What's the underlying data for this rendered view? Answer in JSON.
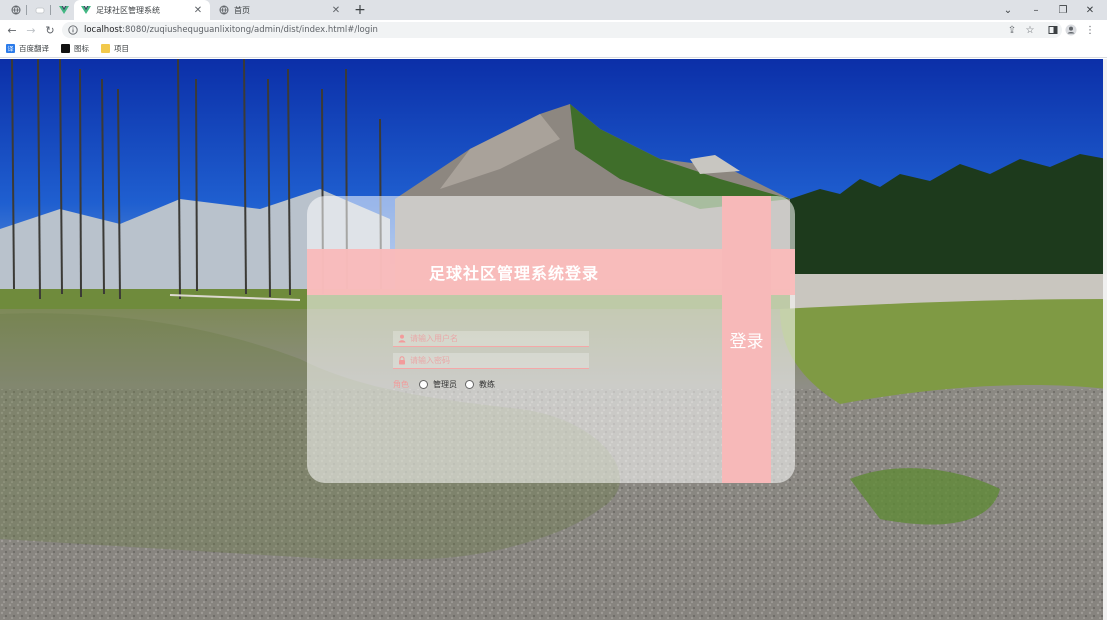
{
  "browser": {
    "tabs": [
      {
        "label": "",
        "icon": "globe-icon",
        "active": false
      },
      {
        "label": "",
        "icon": "cloud-icon",
        "active": false
      },
      {
        "label": "",
        "icon": "vue-icon",
        "active": false
      },
      {
        "label": "足球社区管理系统",
        "icon": "vue-icon",
        "active": true
      },
      {
        "label": "首页",
        "icon": "globe-icon",
        "active": false
      }
    ],
    "address": {
      "host": "localhost",
      "path": ":8080/zuqiushequguanlixitong/admin/dist/index.html#/login"
    },
    "bookmarks": [
      {
        "label": "百度翻译",
        "icon": "translate-icon",
        "color": "#2b7bea"
      },
      {
        "label": "图标",
        "icon": "icon-bookmark-icon",
        "color": "#111111"
      },
      {
        "label": "项目",
        "icon": "folder-icon",
        "color": "#f2c94c"
      }
    ]
  },
  "login": {
    "title": "足球社区管理系统登录",
    "username_placeholder": "请输入用户名",
    "password_placeholder": "请输入密码",
    "role_label": "角色",
    "roles": [
      "管理员",
      "教练"
    ],
    "submit_label": "登录"
  },
  "colors": {
    "accent": "#f7b9b9",
    "title_text": "#ffffff"
  }
}
